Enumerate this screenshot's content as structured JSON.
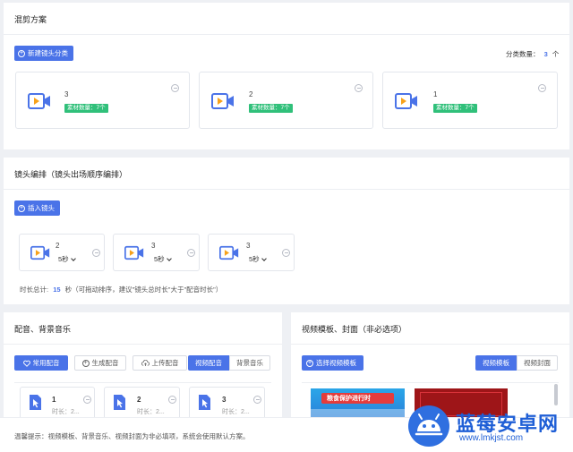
{
  "mix": {
    "title": "混剪方案",
    "new_button": "新建镜头分类",
    "count_label": "分类数量：",
    "count_value": "3",
    "count_unit": "个",
    "categories": [
      {
        "num": "3",
        "tag": "素材数量：7个"
      },
      {
        "num": "2",
        "tag": "素材数量：7个"
      },
      {
        "num": "1",
        "tag": "素材数量：7个"
      }
    ]
  },
  "shots": {
    "title": "镜头编排（镜头出场顺序编排）",
    "insert_button": "插入镜头",
    "items": [
      {
        "num": "2",
        "duration": "5秒"
      },
      {
        "num": "3",
        "duration": "5秒"
      },
      {
        "num": "3",
        "duration": "5秒"
      }
    ],
    "total_label": "时长总计:",
    "total_value": "15",
    "total_note": "秒（可拖动排序，建议\"镜头总时长\"大于\"配音时长\"）"
  },
  "audio": {
    "title": "配音、背景音乐",
    "buttons": {
      "common": "常用配音",
      "generate": "生成配音",
      "upload": "上传配音",
      "voice_tab": "视频配音",
      "bgm_tab": "背景音乐"
    },
    "files": [
      {
        "num": "1",
        "duration": "时长：2..."
      },
      {
        "num": "2",
        "duration": "时长：2..."
      },
      {
        "num": "3",
        "duration": "时长：2..."
      }
    ]
  },
  "template": {
    "title": "视频模板、封面（非必选项）",
    "select_button": "选择视频模板",
    "tabs": [
      "视频模板",
      "视频封面"
    ],
    "thumb_text": "粮食保护进行时"
  },
  "footer": {
    "tip": "温馨提示：视频模板、背景音乐、视频封面为非必填项，系统会使用默认方案。"
  },
  "watermark": {
    "brand": "蓝莓安卓网",
    "url": "www.lmkjst.com"
  },
  "colors": {
    "primary": "#4a73e8",
    "tag_green": "#30c07a",
    "camera_orange": "#f7a21b"
  }
}
